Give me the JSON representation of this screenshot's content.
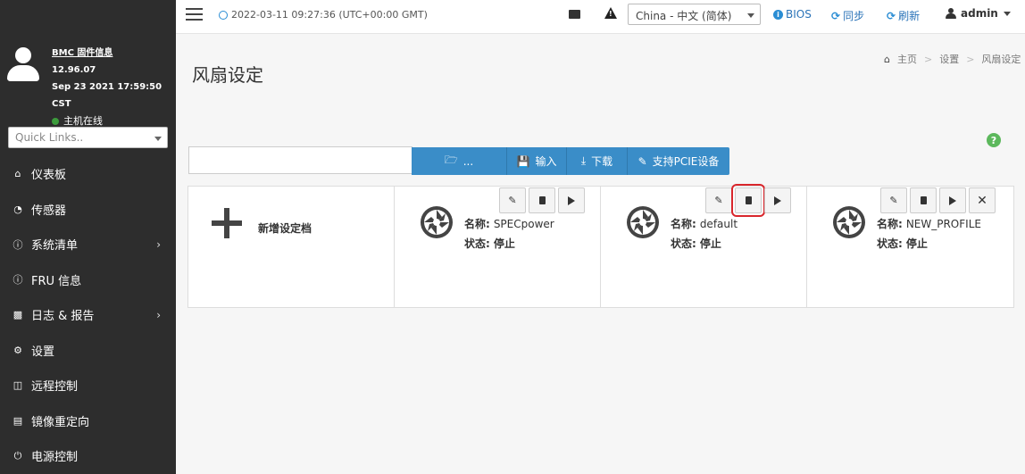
{
  "header": {
    "datetime": "2022-03-11 09:27:36 (UTC+00:00 GMT)",
    "language": "China - 中文 (简体)",
    "bios_label": "BIOS",
    "sync_label": "同步",
    "refresh_label": "刷新",
    "user": "admin"
  },
  "sidebar": {
    "fw_info_label": "BMC 固件信息",
    "fw_version": "12.96.07",
    "fw_date": "Sep 23 2021 17:59:50 CST",
    "host_status": "主机在线",
    "quick_links_placeholder": "Quick Links..",
    "items": [
      {
        "label": "仪表板",
        "icon": "dashboard-icon"
      },
      {
        "label": "传感器",
        "icon": "gauge-icon"
      },
      {
        "label": "系统清单",
        "icon": "info-icon",
        "has_submenu": true
      },
      {
        "label": "FRU 信息",
        "icon": "info-icon"
      },
      {
        "label": "日志 & 报告",
        "icon": "bar-chart-icon",
        "has_submenu": true
      },
      {
        "label": "设置",
        "icon": "gear-icon"
      },
      {
        "label": "远程控制",
        "icon": "monitor-icon"
      },
      {
        "label": "镜像重定向",
        "icon": "drive-icon"
      },
      {
        "label": "电源控制",
        "icon": "power-icon"
      }
    ]
  },
  "page": {
    "title": "风扇设定",
    "breadcrumb": [
      "主页",
      "设置",
      "风扇设定"
    ]
  },
  "toolbar": {
    "browse_label": "...",
    "import_label": "输入",
    "download_label": "下载",
    "pcie_label": "支持PCIE设备"
  },
  "profiles": {
    "add_label": "新增设定档",
    "name_prefix": "名称:",
    "status_prefix": "状态:",
    "items": [
      {
        "name": "SPECpower",
        "status": "停止"
      },
      {
        "name": "default",
        "status": "停止"
      },
      {
        "name": "NEW_PROFILE",
        "status": "停止"
      }
    ]
  },
  "colors": {
    "sidebar_bg": "#2d2d2d",
    "primary_button": "#3a8dc8",
    "highlight_box": "#d9262c",
    "online_dot": "#3c9b3c",
    "help_icon": "#5cb85c"
  }
}
